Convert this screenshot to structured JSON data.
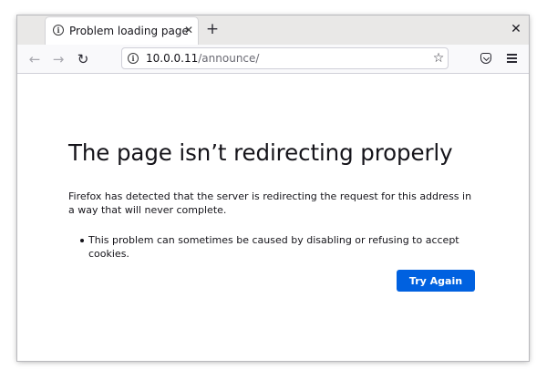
{
  "browser": {
    "tab": {
      "title": "Problem loading page",
      "info_icon": "info-icon",
      "close_icon": "close-icon"
    },
    "new_tab_icon": "plus-icon",
    "window_close_icon": "close-icon",
    "nav": {
      "back_icon": "arrow-left-icon",
      "forward_icon": "arrow-right-icon",
      "reload_icon": "reload-icon"
    },
    "urlbar": {
      "host": "10.0.0.11",
      "path": "/announce/",
      "info_icon": "info-icon",
      "bookmark_icon": "star-icon"
    },
    "toolbar": {
      "pocket_icon": "pocket-icon",
      "menu_icon": "hamburger-menu-icon"
    }
  },
  "error_page": {
    "title": "The page isn’t redirecting properly",
    "description": "Firefox has detected that the server is redirecting the request for this address in a way that will never complete.",
    "bullets": [
      "This problem can sometimes be caused by disabling or refusing to accept cookies."
    ],
    "button_label": "Try Again",
    "accent_color": "#0061e0"
  }
}
